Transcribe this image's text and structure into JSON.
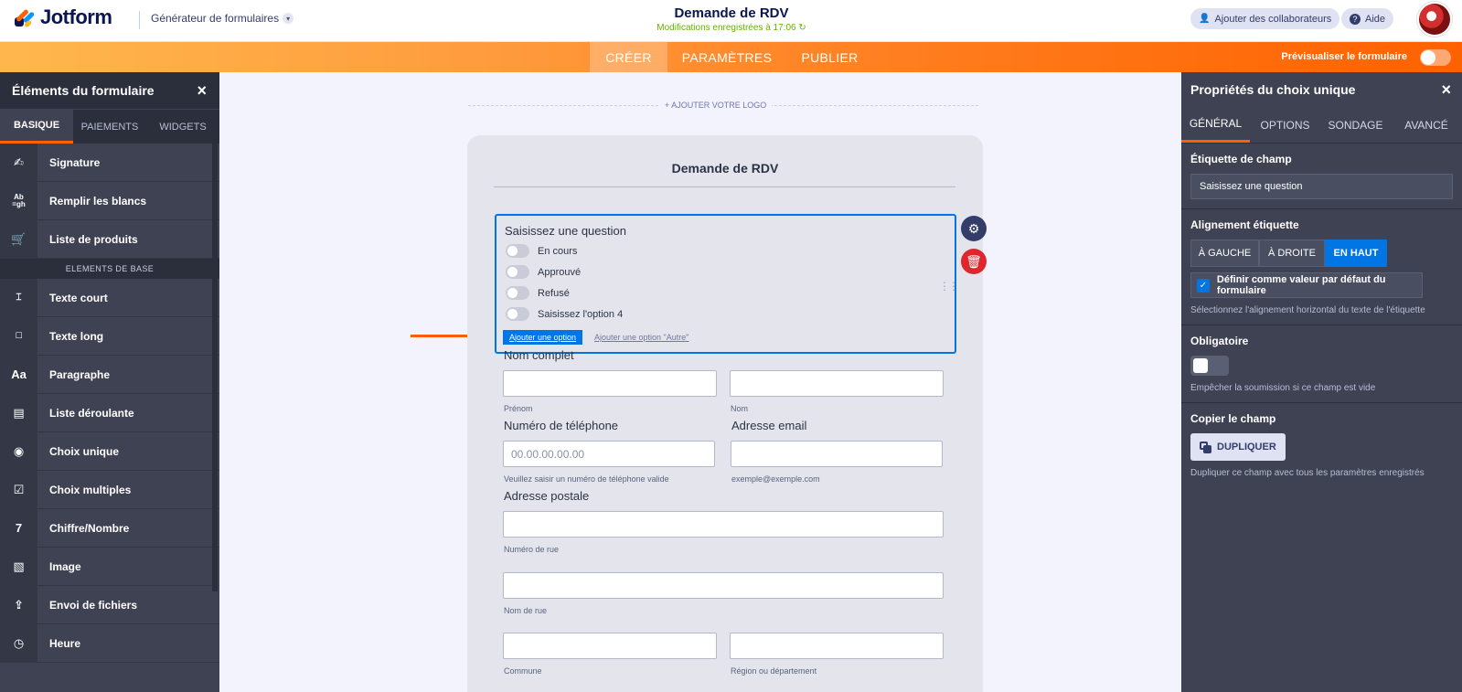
{
  "header": {
    "logo_text": "Jotform",
    "generator_label": "Générateur de formulaires",
    "form_title": "Demande de RDV",
    "saved_status": "Modifications enregistrées à 17:06 ↻",
    "collab_button": "Ajouter des collaborateurs",
    "help_button": "Aide"
  },
  "nav": {
    "tabs": [
      "CRÉER",
      "PARAMÈTRES",
      "PUBLIER"
    ],
    "active_tab": "CRÉER",
    "preview_label": "Prévisualiser le formulaire"
  },
  "left_panel": {
    "title": "Éléments du formulaire",
    "tabs": [
      "BASIQUE",
      "PAIEMENTS",
      "WIDGETS"
    ],
    "items_top": [
      {
        "label": "Signature",
        "icon": "signature-icon"
      },
      {
        "label": "Remplir les blancs",
        "icon": "fill-blanks-icon"
      },
      {
        "label": "Liste de produits",
        "icon": "cart-icon"
      }
    ],
    "section_label": "ELEMENTS DE BASE",
    "items_basic": [
      {
        "label": "Texte court",
        "icon": "short-text-icon"
      },
      {
        "label": "Texte long",
        "icon": "long-text-icon"
      },
      {
        "label": "Paragraphe",
        "icon": "paragraph-icon"
      },
      {
        "label": "Liste déroulante",
        "icon": "dropdown-icon"
      },
      {
        "label": "Choix unique",
        "icon": "radio-icon"
      },
      {
        "label": "Choix multiples",
        "icon": "checkbox-icon"
      },
      {
        "label": "Chiffre/Nombre",
        "icon": "number-icon"
      },
      {
        "label": "Image",
        "icon": "image-icon"
      },
      {
        "label": "Envoi de fichiers",
        "icon": "upload-icon"
      },
      {
        "label": "Heure",
        "icon": "clock-icon"
      }
    ]
  },
  "canvas": {
    "add_logo": "+ AJOUTER VOTRE LOGO",
    "form_heading": "Demande de RDV",
    "question_label": "Saisissez une question",
    "options": [
      "En cours",
      "Approuvé",
      "Refusé",
      "Saisissez l'option 4"
    ],
    "add_option": "Ajouter une option",
    "add_other_option": "Ajouter une option \"Autre\"",
    "full_name_label": "Nom complet",
    "first_name_sub": "Prénom",
    "last_name_sub": "Nom",
    "phone_label": "Numéro de téléphone",
    "phone_placeholder": "00.00.00.00.00",
    "phone_sub": "Veuillez saisir un numéro de téléphone valide",
    "email_label": "Adresse email",
    "email_sub": "exemple@exemple.com",
    "address_label": "Adresse postale",
    "street_number_sub": "Numéro de rue",
    "street_name_sub": "Nom de rue",
    "city_sub": "Commune",
    "region_sub": "Région ou département"
  },
  "right_panel": {
    "title": "Propriétés du choix unique",
    "tabs": [
      "GÉNÉRAL",
      "OPTIONS",
      "SONDAGE",
      "AVANCÉ"
    ],
    "field_label_title": "Étiquette de champ",
    "field_label_value": "Saisissez une question",
    "alignment_title": "Alignement étiquette",
    "alignment_options": [
      "À GAUCHE",
      "À DROITE",
      "EN HAUT"
    ],
    "alignment_selected": "EN HAUT",
    "default_checkbox": "Définir comme valeur par défaut du formulaire",
    "alignment_help": "Sélectionnez l'alignement horizontal du texte de l'étiquette",
    "required_title": "Obligatoire",
    "required_help": "Empêcher la soumission si ce champ est vide",
    "copy_title": "Copier le champ",
    "duplicate_button": "DUPLIQUER",
    "duplicate_help": "Dupliquer ce champ avec tous les paramètres enregistrés"
  },
  "colors": {
    "accent_orange": "#ff6100",
    "primary_blue": "#0075e3",
    "panel_dark": "#3e4252",
    "delete_red": "#e0252d"
  }
}
